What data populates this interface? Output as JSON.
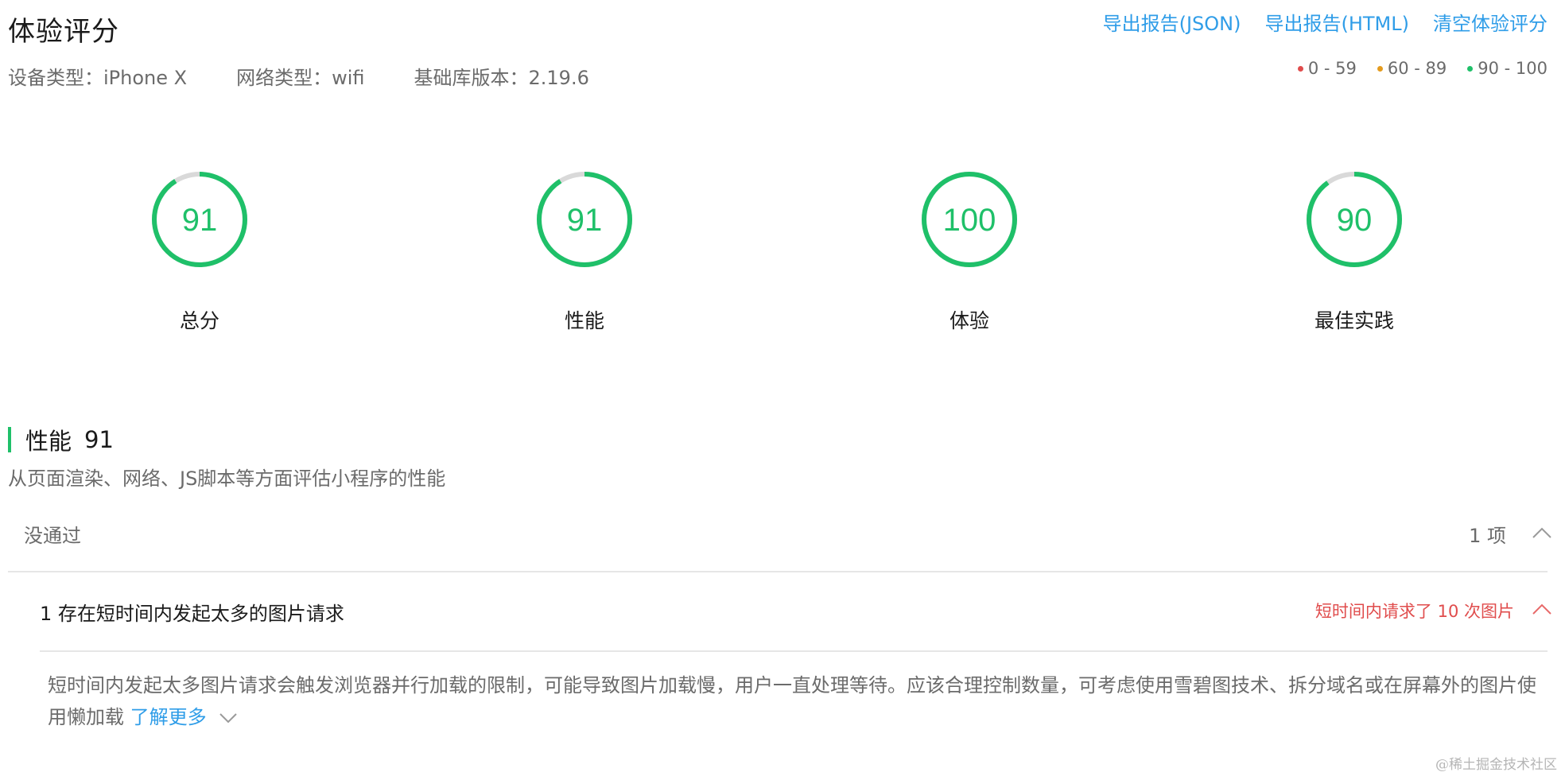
{
  "header": {
    "title": "体验评分",
    "links": {
      "export_json": "导出报告(JSON)",
      "export_html": "导出报告(HTML)",
      "clear": "清空体验评分"
    }
  },
  "device_info": {
    "device": "设备类型：iPhone X",
    "network": "网络类型：wifi",
    "lib_version": "基础库版本：2.19.6"
  },
  "legend": {
    "low": "0 - 59",
    "mid": "60 - 89",
    "high": "90 - 100"
  },
  "colors": {
    "low": "#e04c4c",
    "mid": "#e49b1e",
    "high": "#1fc069",
    "ring_track": "#d9d9d9",
    "link": "#2f9de8"
  },
  "scores": [
    {
      "label": "总分",
      "value": "91",
      "fraction": 0.91
    },
    {
      "label": "性能",
      "value": "91",
      "fraction": 0.91
    },
    {
      "label": "体验",
      "value": "100",
      "fraction": 1.0
    },
    {
      "label": "最佳实践",
      "value": "90",
      "fraction": 0.9
    }
  ],
  "section": {
    "name": "性能",
    "score": "91",
    "description": "从页面渲染、网络、JS脚本等方面评估小程序的性能"
  },
  "failed": {
    "label": "没通过",
    "count": "1 项"
  },
  "issue": {
    "title": "1 存在短时间内发起太多的图片请求",
    "note": "短时间内请求了 10 次图片",
    "description": "短时间内发起太多图片请求会触发浏览器并行加载的限制，可能导致图片加载慢，用户一直处理等待。应该合理控制数量，可考虑使用雪碧图技术、拆分域名或在屏幕外的图片使用懒加载",
    "learn_more": "了解更多"
  },
  "watermark": "@稀土掘金技术社区"
}
